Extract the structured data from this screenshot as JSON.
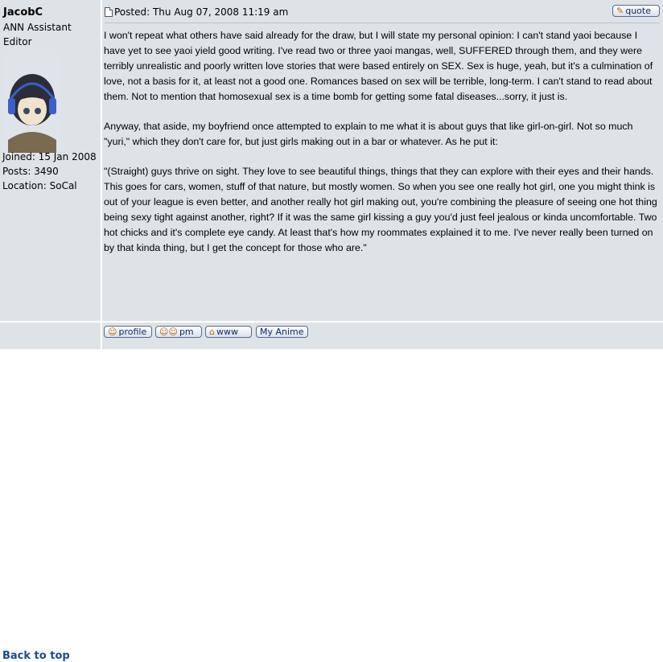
{
  "author": {
    "username": "JacobC",
    "rank_line1": "ANN Assistant",
    "rank_line2": "Editor",
    "joined": "Joined: 15 Jan 2008",
    "posts": "Posts: 3490",
    "location": "Location: SoCal"
  },
  "post": {
    "posted": "Posted: Thu Aug 07, 2008 11:19 am",
    "quote_label": "quote",
    "paragraphs": [
      "I won't repeat what others have said already for the draw, but I will state my personal opinion: I can't stand yaoi because I have yet to see yaoi yield good writing. I've read two or three yaoi mangas, well, SUFFERED through them, and they were terribly unrealistic and poorly written love stories that were based entirely on SEX. Sex is huge, yeah, but it's a culmination of love, not a basis for it, at least not a good one. Romances based on sex will be terrible, long-term. I can't stand to read about them. Not to mention that homosexual sex is a time bomb for getting some fatal diseases...sorry, it just is.",
      "Anyway, that aside, my boyfriend once attempted to explain to me what it is about guys that like girl-on-girl. Not so much \"yuri,\" which they don't care for, but just girls making out in a bar or whatever. As he put it:",
      "\"(Straight) guys thrive on sight. They love to see beautiful things, things that they can explore with their eyes and their hands. This goes for cars, women, stuff of that nature, but mostly women. So when you see one really hot girl, one you might think is out of your league is even better, and another really hot girl making out, you're combining the pleasure of seeing one hot thing being sexy tight against another, right? If it was the same girl kissing a guy you'd just feel jealous or kinda uncomfortable. Two hot chicks and it's complete eye candy. At least that's how my roommates explained it to me. I've never really been turned on by that kinda thing, but I get the concept for those who are.\""
    ]
  },
  "footer": {
    "back_to_top": "Back to top",
    "profile": "profile",
    "pm": "pm",
    "www": "www",
    "my_anime": "My Anime"
  },
  "colors": {
    "cell_bg": "#dee3e7",
    "link": "#1a4b8c"
  }
}
